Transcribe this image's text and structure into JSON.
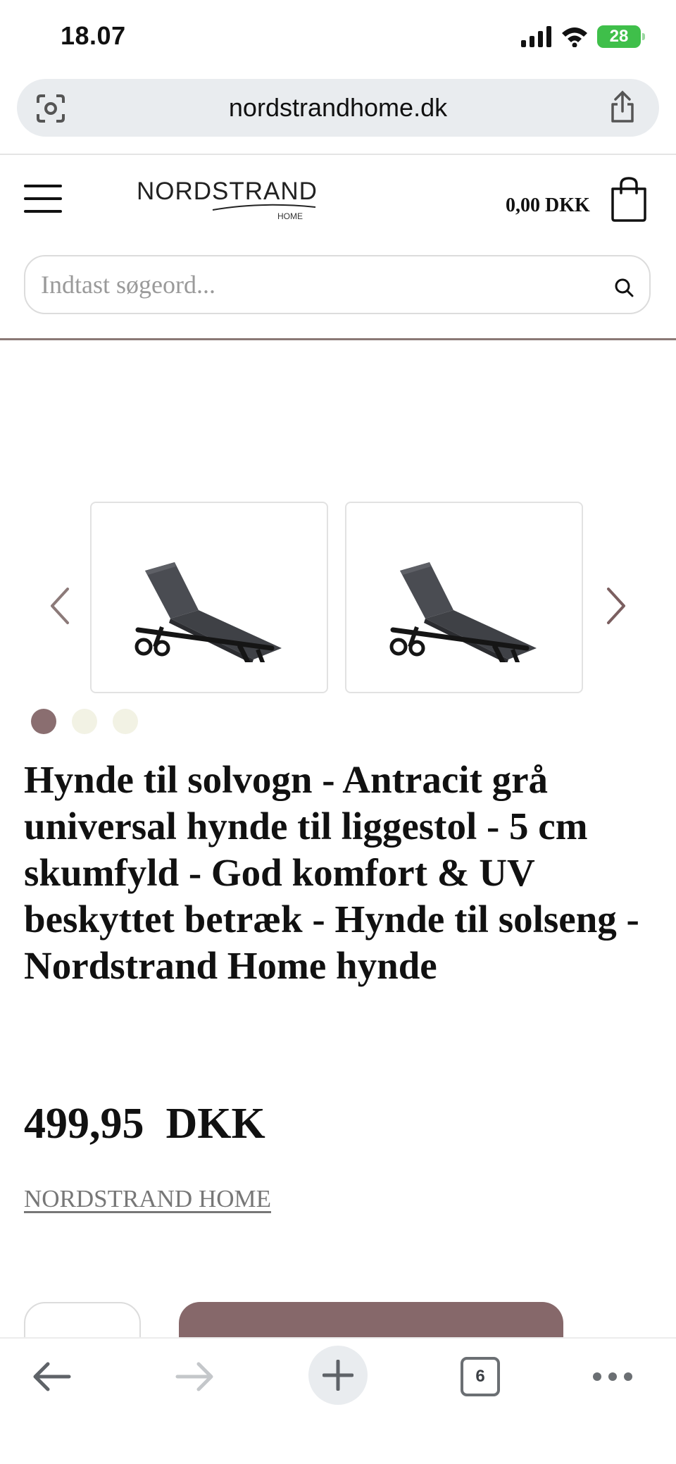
{
  "status_bar": {
    "time": "18.07",
    "battery": "28",
    "icons": [
      "signal-icon",
      "wifi-icon",
      "battery-icon"
    ]
  },
  "browser": {
    "url": "nordstrandhome.dk",
    "open_tabs": "6",
    "icons": [
      "lens-icon",
      "share-icon",
      "back-icon",
      "forward-icon",
      "new-tab-icon",
      "tabs-icon",
      "more-icon"
    ]
  },
  "header": {
    "logo_word": "NORDSTRAND",
    "logo_sub": "HOME",
    "cart_total": "0,00 DKK"
  },
  "search": {
    "placeholder": "Indtast søgeord..."
  },
  "gallery": {
    "image_count": 3,
    "active_index": 0
  },
  "product": {
    "title": "Hynde til solvogn - Antracit grå universal hynde til liggestol - 5 cm skumfyld - God komfort & UV beskyttet betræk - Hynde til solseng - Nordstrand Home hynde",
    "price": "499,95  DKK",
    "brand": "NORDSTRAND HOME"
  },
  "colors": {
    "accent": "#86686a",
    "divider": "#8a7875",
    "dot_inactive": "#f2f2e4"
  }
}
